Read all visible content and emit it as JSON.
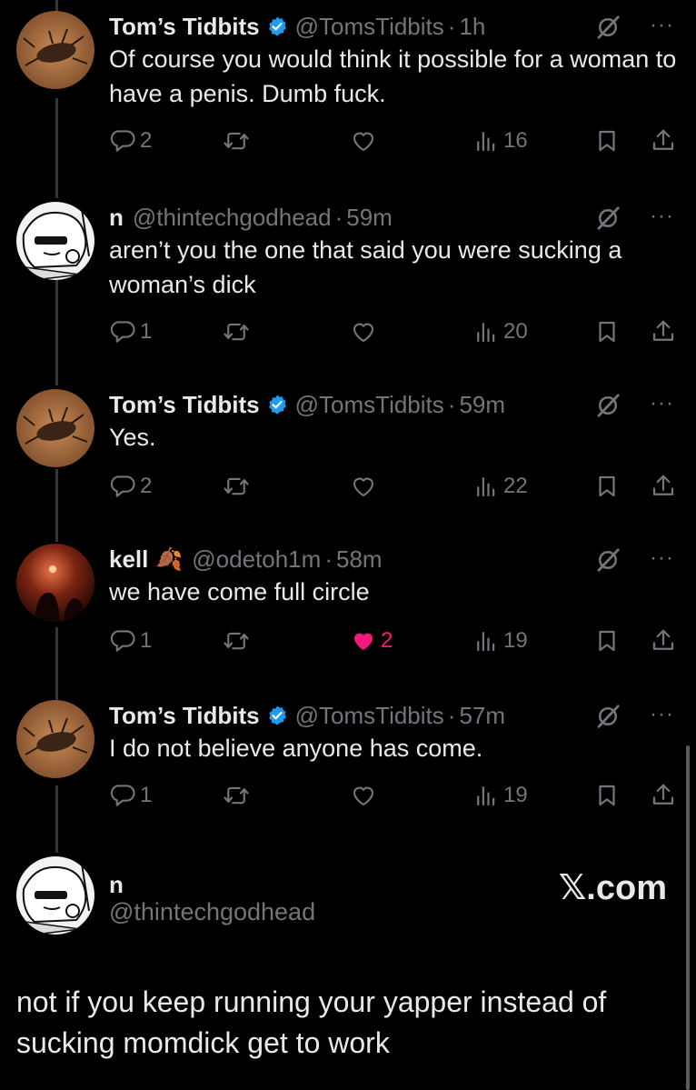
{
  "colors": {
    "background": "#000000",
    "text": "#e7e9ea",
    "muted": "#71767b",
    "like": "#f91880",
    "verified": "#1d9bf0"
  },
  "tweets": [
    {
      "name": "Tom’s Tidbits",
      "verified": true,
      "emoji": "",
      "handle": "@TomsTidbits",
      "time": "1h",
      "text": "Of course you would think it possible for a woman to have a penis. Dumb fuck.",
      "replies": "2",
      "retweets": "",
      "likes": "",
      "views": "16",
      "liked": false,
      "avatar": "bug-avatar"
    },
    {
      "name": "n",
      "verified": false,
      "emoji": "",
      "handle": "@thintechgodhead",
      "time": "59m",
      "text": "aren’t you the one that said you were sucking a woman’s dick",
      "replies": "1",
      "retweets": "",
      "likes": "",
      "views": "20",
      "liked": false,
      "avatar": "cartoon-avatar"
    },
    {
      "name": "Tom’s Tidbits",
      "verified": true,
      "emoji": "",
      "handle": "@TomsTidbits",
      "time": "59m",
      "text": "Yes.",
      "replies": "2",
      "retweets": "",
      "likes": "",
      "views": "22",
      "liked": false,
      "avatar": "bug-avatar"
    },
    {
      "name": "kell",
      "verified": false,
      "emoji": "🍂",
      "handle": "@odetoh1m",
      "time": "58m",
      "text": "we have come full circle",
      "replies": "1",
      "retweets": "",
      "likes": "2",
      "views": "19",
      "liked": true,
      "avatar": "dark-avatar"
    },
    {
      "name": "Tom’s Tidbits",
      "verified": true,
      "emoji": "",
      "handle": "@TomsTidbits",
      "time": "57m",
      "text": "I do not believe anyone has come.",
      "replies": "1",
      "retweets": "",
      "likes": "",
      "views": "19",
      "liked": false,
      "avatar": "bug-avatar"
    }
  ],
  "final": {
    "name": "n",
    "handle": "@thintechgodhead",
    "brand": "𝕏.com",
    "text": "not if you keep running your yapper instead of sucking momdick get to work"
  },
  "icons": {
    "reply": "reply-icon",
    "retweet": "retweet-icon",
    "like": "heart-icon",
    "views": "views-icon",
    "bookmark": "bookmark-icon",
    "share": "share-icon",
    "grok": "grok-icon",
    "more": "more-icon",
    "verified": "verified-badge-icon"
  }
}
